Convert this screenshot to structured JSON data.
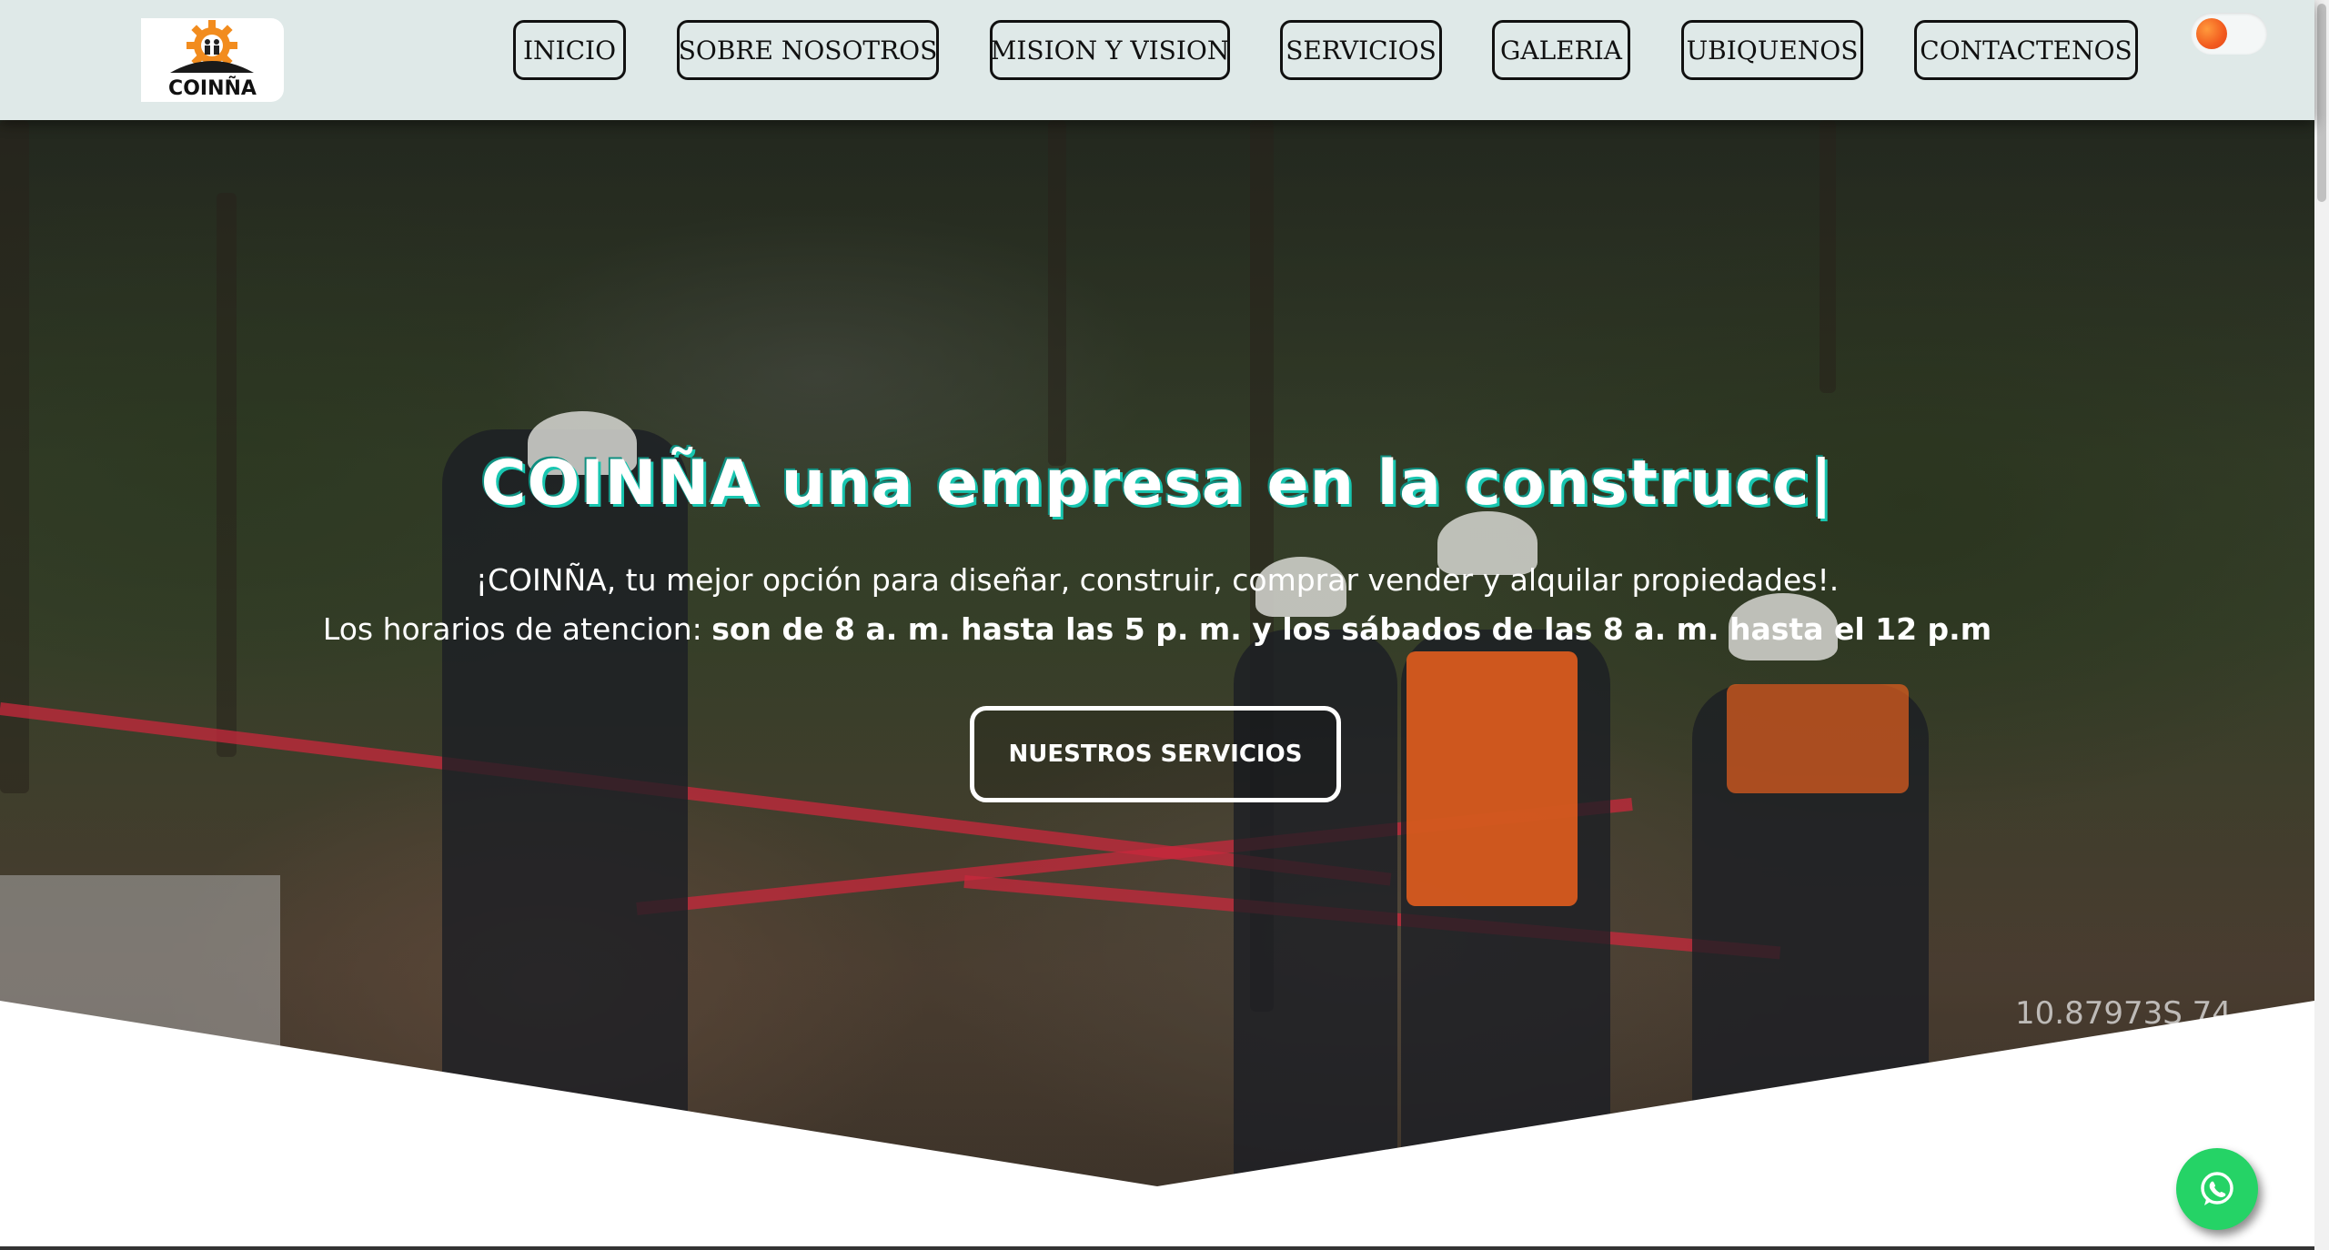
{
  "brand": {
    "logo_text": "COINÑA"
  },
  "nav": {
    "items": [
      {
        "label": "INICIO"
      },
      {
        "label": "SOBRE NOSOTROS"
      },
      {
        "label": "MISION Y VISION"
      },
      {
        "label": "SERVICIOS"
      },
      {
        "label": "GALERIA"
      },
      {
        "label": "UBIQUENOS"
      },
      {
        "label": "CONTACTENOS"
      }
    ]
  },
  "theme_toggle": {
    "icon": "sun-icon",
    "state": "light"
  },
  "hero": {
    "title": "COINÑA una empresa en la construcc|",
    "line1": "¡COINÑA, tu mejor opción para diseñar, construir, comprar vender y alquilar propiedades!.",
    "line2_prefix": "Los horarios de atencion: ",
    "line2_bold": "son de 8 a. m. hasta las 5 p. m. y los sábados de las 8 a. m. hasta el 12 p.m",
    "cta_label": "NUESTROS SERVICIOS",
    "photo_overlay_text": "10.87973S 74"
  },
  "whatsapp": {
    "icon": "whatsapp-icon"
  },
  "colors": {
    "header_bg": "#dfe9e8",
    "title_glow": "#18c6b0",
    "whatsapp_green": "#25d366",
    "logo_orange": "#f28c1e"
  }
}
